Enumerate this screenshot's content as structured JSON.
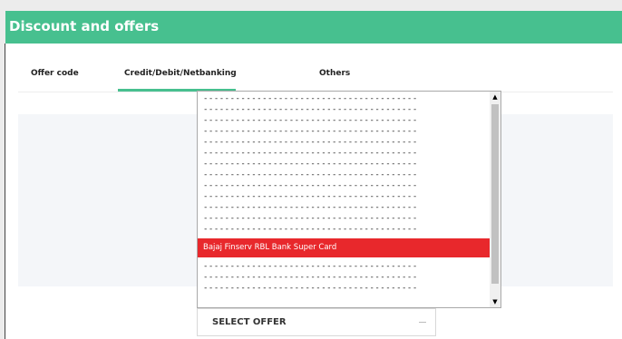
{
  "header": {
    "title": "Discount and offers"
  },
  "tabs": [
    {
      "label": "Offer code",
      "active": false
    },
    {
      "label": "Credit/Debit/Netbanking",
      "active": true
    },
    {
      "label": "Others",
      "active": false
    }
  ],
  "dropdown": {
    "options": [
      "----------------------------------------",
      "----------------------------------------",
      "----------------------------------------",
      "----------------------------------------",
      "----------------------------------------",
      "----------------------------------------",
      "----------------------------------------",
      "----------------------------------------",
      "----------------------------------------",
      "----------------------------------------",
      "----------------------------------------",
      "----------------------------------------",
      "----------------------------------------",
      "Bajaj Finserv RBL Bank Super Card",
      "----------------------------------------",
      "----------------------------------------",
      "----------------------------------------"
    ],
    "selected_index": 13,
    "scroll_up_glyph": "▲",
    "scroll_down_glyph": "▼"
  },
  "select": {
    "label": "SELECT OFFER"
  },
  "colors": {
    "header_bg": "#47c08f",
    "selected_option_bg": "#e8282c",
    "tab_underline": "#47c08f"
  }
}
